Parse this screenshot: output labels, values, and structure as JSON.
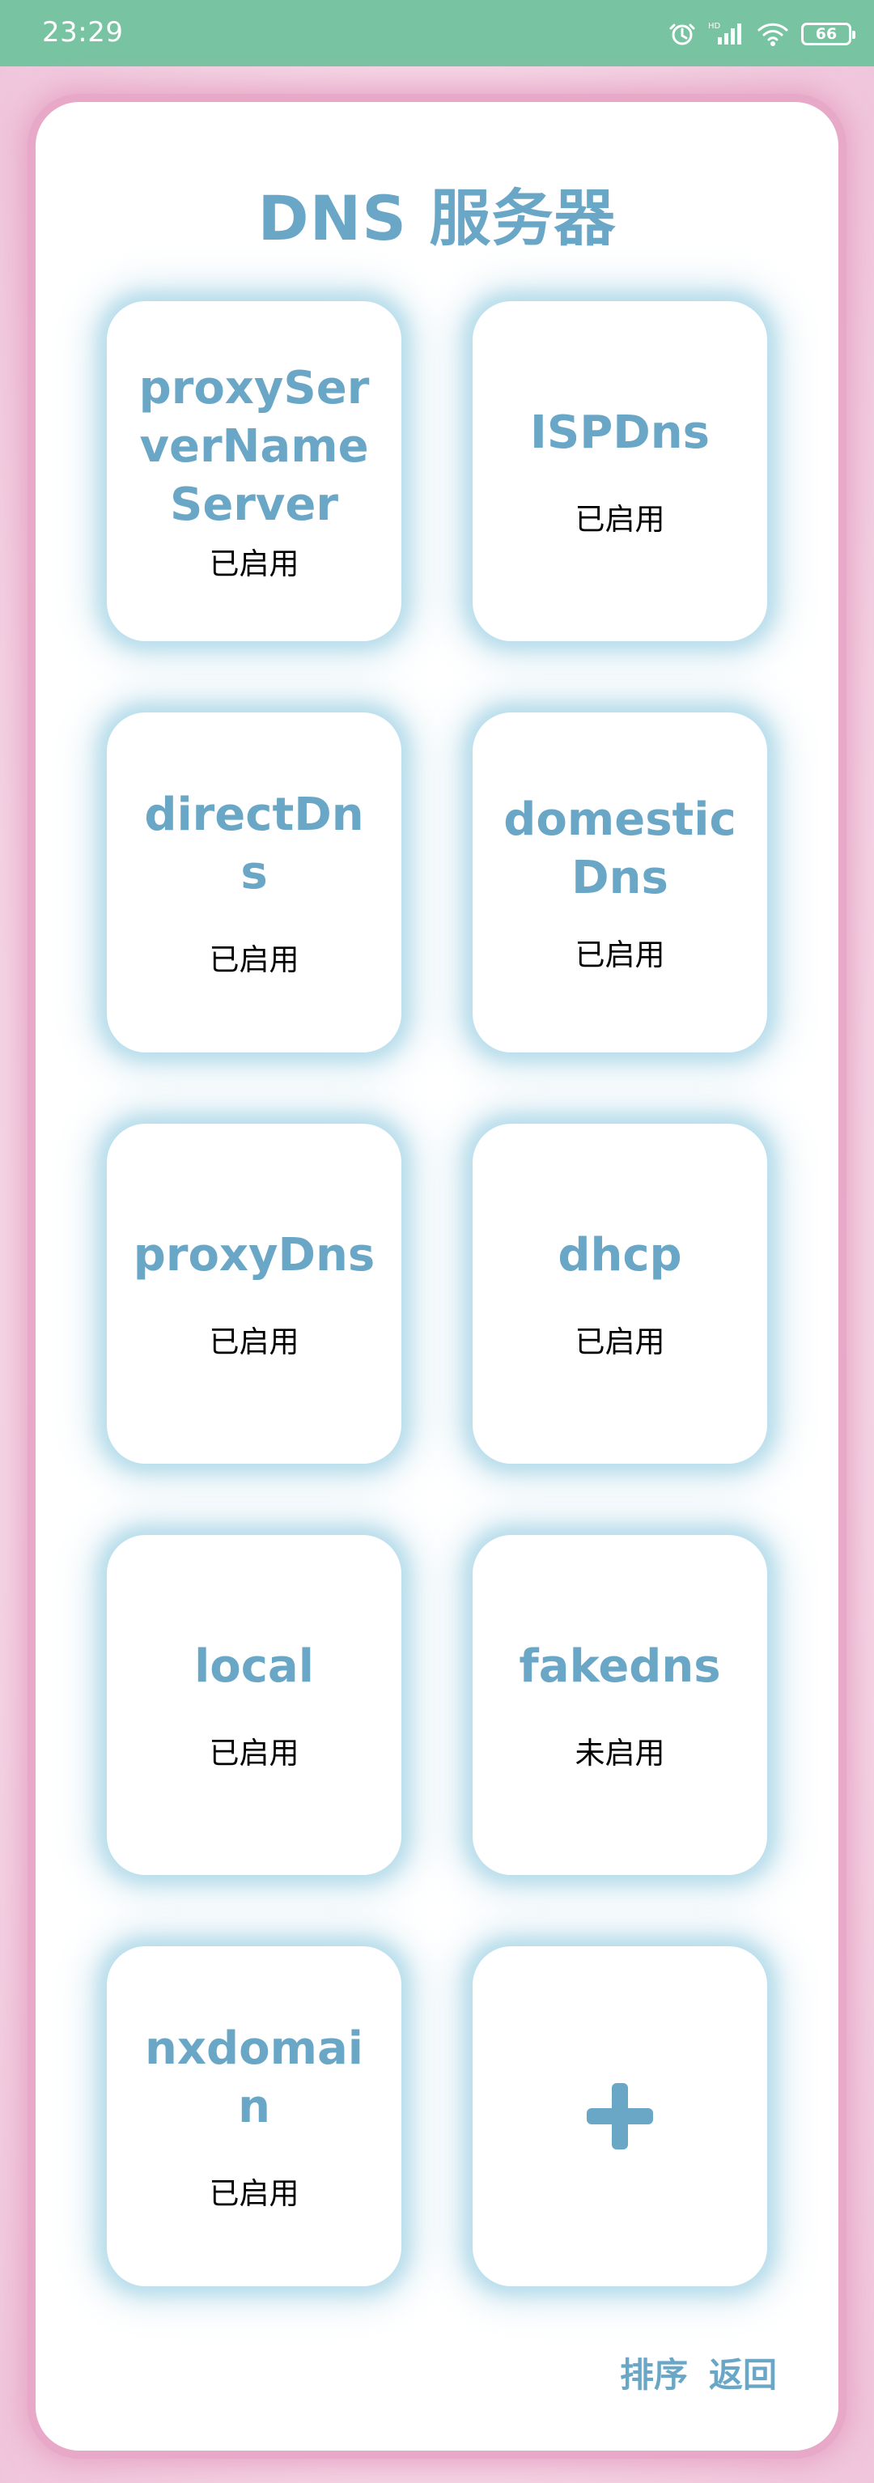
{
  "status_bar": {
    "time": "23:29",
    "battery": "66",
    "icons": [
      "alarm-icon",
      "hd-signal-icon",
      "wifi-icon",
      "battery-icon"
    ]
  },
  "panel": {
    "title": "DNS 服务器",
    "cards": [
      {
        "name": "proxyServerNameServer",
        "status": "已启用"
      },
      {
        "name": "ISPDns",
        "status": "已启用"
      },
      {
        "name": "directDns",
        "status": "已启用"
      },
      {
        "name": "domesticDns",
        "status": "已启用"
      },
      {
        "name": "proxyDns",
        "status": "已启用"
      },
      {
        "name": "dhcp",
        "status": "已启用"
      },
      {
        "name": "local",
        "status": "已启用"
      },
      {
        "name": "fakedns",
        "status": "未启用"
      },
      {
        "name": "nxdomain",
        "status": "已启用"
      }
    ],
    "add_icon": "plus-icon",
    "footer": {
      "sort": "排序",
      "back": "返回"
    }
  },
  "colors": {
    "status_bar": "#78c3a1",
    "panel_border": "#e7a9c7",
    "accent": "#6aa7c7",
    "card_glow": "#b7ddeb"
  }
}
